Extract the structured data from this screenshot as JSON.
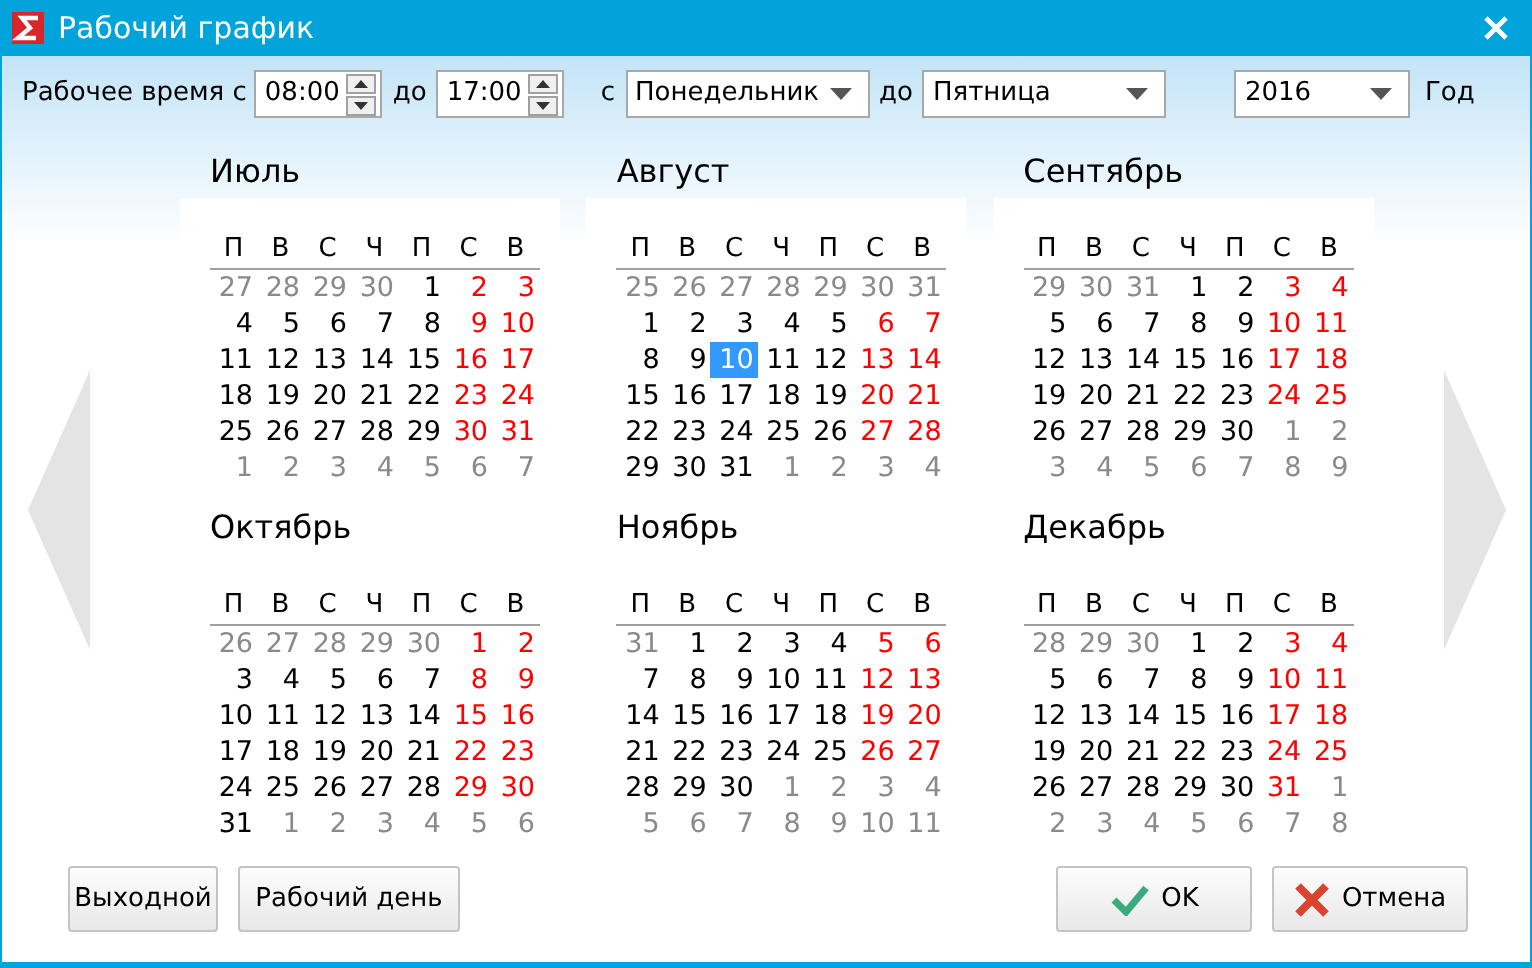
{
  "window": {
    "title": "Рабочий график"
  },
  "toolbar": {
    "time_label": "Рабочее время с",
    "time_from": "08:00",
    "time_to_label": "до",
    "time_to": "17:00",
    "day_from_label": "с",
    "day_from": "Понедельник",
    "day_to_label": "до",
    "day_to": "Пятница",
    "year": "2016",
    "year_label": "Год"
  },
  "months": [
    {
      "name": "Июль",
      "weekdays": [
        "П",
        "В",
        "С",
        "Ч",
        "П",
        "С",
        "В"
      ],
      "weeks": [
        [
          {
            "text": "27",
            "kind": "other",
            "selected": false
          },
          {
            "text": "28",
            "kind": "other",
            "selected": false
          },
          {
            "text": "29",
            "kind": "other",
            "selected": false
          },
          {
            "text": "30",
            "kind": "other",
            "selected": false
          },
          {
            "text": "1",
            "kind": "work",
            "selected": false
          },
          {
            "text": "2",
            "kind": "weekend",
            "selected": false
          },
          {
            "text": "3",
            "kind": "weekend",
            "selected": false
          }
        ],
        [
          {
            "text": "4",
            "kind": "work",
            "selected": false
          },
          {
            "text": "5",
            "kind": "work",
            "selected": false
          },
          {
            "text": "6",
            "kind": "work",
            "selected": false
          },
          {
            "text": "7",
            "kind": "work",
            "selected": false
          },
          {
            "text": "8",
            "kind": "work",
            "selected": false
          },
          {
            "text": "9",
            "kind": "weekend",
            "selected": false
          },
          {
            "text": "10",
            "kind": "weekend",
            "selected": false
          }
        ],
        [
          {
            "text": "11",
            "kind": "work",
            "selected": false
          },
          {
            "text": "12",
            "kind": "work",
            "selected": false
          },
          {
            "text": "13",
            "kind": "work",
            "selected": false
          },
          {
            "text": "14",
            "kind": "work",
            "selected": false
          },
          {
            "text": "15",
            "kind": "work",
            "selected": false
          },
          {
            "text": "16",
            "kind": "weekend",
            "selected": false
          },
          {
            "text": "17",
            "kind": "weekend",
            "selected": false
          }
        ],
        [
          {
            "text": "18",
            "kind": "work",
            "selected": false
          },
          {
            "text": "19",
            "kind": "work",
            "selected": false
          },
          {
            "text": "20",
            "kind": "work",
            "selected": false
          },
          {
            "text": "21",
            "kind": "work",
            "selected": false
          },
          {
            "text": "22",
            "kind": "work",
            "selected": false
          },
          {
            "text": "23",
            "kind": "weekend",
            "selected": false
          },
          {
            "text": "24",
            "kind": "weekend",
            "selected": false
          }
        ],
        [
          {
            "text": "25",
            "kind": "work",
            "selected": false
          },
          {
            "text": "26",
            "kind": "work",
            "selected": false
          },
          {
            "text": "27",
            "kind": "work",
            "selected": false
          },
          {
            "text": "28",
            "kind": "work",
            "selected": false
          },
          {
            "text": "29",
            "kind": "work",
            "selected": false
          },
          {
            "text": "30",
            "kind": "weekend",
            "selected": false
          },
          {
            "text": "31",
            "kind": "weekend",
            "selected": false
          }
        ],
        [
          {
            "text": "1",
            "kind": "other",
            "selected": false
          },
          {
            "text": "2",
            "kind": "other",
            "selected": false
          },
          {
            "text": "3",
            "kind": "other",
            "selected": false
          },
          {
            "text": "4",
            "kind": "other",
            "selected": false
          },
          {
            "text": "5",
            "kind": "other",
            "selected": false
          },
          {
            "text": "6",
            "kind": "other",
            "selected": false
          },
          {
            "text": "7",
            "kind": "other",
            "selected": false
          }
        ]
      ]
    },
    {
      "name": "Август",
      "weekdays": [
        "П",
        "В",
        "С",
        "Ч",
        "П",
        "С",
        "В"
      ],
      "weeks": [
        [
          {
            "text": "25",
            "kind": "other",
            "selected": false
          },
          {
            "text": "26",
            "kind": "other",
            "selected": false
          },
          {
            "text": "27",
            "kind": "other",
            "selected": false
          },
          {
            "text": "28",
            "kind": "other",
            "selected": false
          },
          {
            "text": "29",
            "kind": "other",
            "selected": false
          },
          {
            "text": "30",
            "kind": "other",
            "selected": false
          },
          {
            "text": "31",
            "kind": "other",
            "selected": false
          }
        ],
        [
          {
            "text": "1",
            "kind": "work",
            "selected": false
          },
          {
            "text": "2",
            "kind": "work",
            "selected": false
          },
          {
            "text": "3",
            "kind": "work",
            "selected": false
          },
          {
            "text": "4",
            "kind": "work",
            "selected": false
          },
          {
            "text": "5",
            "kind": "work",
            "selected": false
          },
          {
            "text": "6",
            "kind": "weekend",
            "selected": false
          },
          {
            "text": "7",
            "kind": "weekend",
            "selected": false
          }
        ],
        [
          {
            "text": "8",
            "kind": "work",
            "selected": false
          },
          {
            "text": "9",
            "kind": "work",
            "selected": false
          },
          {
            "text": "10",
            "kind": "work",
            "selected": true
          },
          {
            "text": "11",
            "kind": "work",
            "selected": false
          },
          {
            "text": "12",
            "kind": "work",
            "selected": false
          },
          {
            "text": "13",
            "kind": "weekend",
            "selected": false
          },
          {
            "text": "14",
            "kind": "weekend",
            "selected": false
          }
        ],
        [
          {
            "text": "15",
            "kind": "work",
            "selected": false
          },
          {
            "text": "16",
            "kind": "work",
            "selected": false
          },
          {
            "text": "17",
            "kind": "work",
            "selected": false
          },
          {
            "text": "18",
            "kind": "work",
            "selected": false
          },
          {
            "text": "19",
            "kind": "work",
            "selected": false
          },
          {
            "text": "20",
            "kind": "weekend",
            "selected": false
          },
          {
            "text": "21",
            "kind": "weekend",
            "selected": false
          }
        ],
        [
          {
            "text": "22",
            "kind": "work",
            "selected": false
          },
          {
            "text": "23",
            "kind": "work",
            "selected": false
          },
          {
            "text": "24",
            "kind": "work",
            "selected": false
          },
          {
            "text": "25",
            "kind": "work",
            "selected": false
          },
          {
            "text": "26",
            "kind": "work",
            "selected": false
          },
          {
            "text": "27",
            "kind": "weekend",
            "selected": false
          },
          {
            "text": "28",
            "kind": "weekend",
            "selected": false
          }
        ],
        [
          {
            "text": "29",
            "kind": "work",
            "selected": false
          },
          {
            "text": "30",
            "kind": "work",
            "selected": false
          },
          {
            "text": "31",
            "kind": "work",
            "selected": false
          },
          {
            "text": "1",
            "kind": "other",
            "selected": false
          },
          {
            "text": "2",
            "kind": "other",
            "selected": false
          },
          {
            "text": "3",
            "kind": "other",
            "selected": false
          },
          {
            "text": "4",
            "kind": "other",
            "selected": false
          }
        ]
      ]
    },
    {
      "name": "Сентябрь",
      "weekdays": [
        "П",
        "В",
        "С",
        "Ч",
        "П",
        "С",
        "В"
      ],
      "weeks": [
        [
          {
            "text": "29",
            "kind": "other",
            "selected": false
          },
          {
            "text": "30",
            "kind": "other",
            "selected": false
          },
          {
            "text": "31",
            "kind": "other",
            "selected": false
          },
          {
            "text": "1",
            "kind": "work",
            "selected": false
          },
          {
            "text": "2",
            "kind": "work",
            "selected": false
          },
          {
            "text": "3",
            "kind": "weekend",
            "selected": false
          },
          {
            "text": "4",
            "kind": "weekend",
            "selected": false
          }
        ],
        [
          {
            "text": "5",
            "kind": "work",
            "selected": false
          },
          {
            "text": "6",
            "kind": "work",
            "selected": false
          },
          {
            "text": "7",
            "kind": "work",
            "selected": false
          },
          {
            "text": "8",
            "kind": "work",
            "selected": false
          },
          {
            "text": "9",
            "kind": "work",
            "selected": false
          },
          {
            "text": "10",
            "kind": "weekend",
            "selected": false
          },
          {
            "text": "11",
            "kind": "weekend",
            "selected": false
          }
        ],
        [
          {
            "text": "12",
            "kind": "work",
            "selected": false
          },
          {
            "text": "13",
            "kind": "work",
            "selected": false
          },
          {
            "text": "14",
            "kind": "work",
            "selected": false
          },
          {
            "text": "15",
            "kind": "work",
            "selected": false
          },
          {
            "text": "16",
            "kind": "work",
            "selected": false
          },
          {
            "text": "17",
            "kind": "weekend",
            "selected": false
          },
          {
            "text": "18",
            "kind": "weekend",
            "selected": false
          }
        ],
        [
          {
            "text": "19",
            "kind": "work",
            "selected": false
          },
          {
            "text": "20",
            "kind": "work",
            "selected": false
          },
          {
            "text": "21",
            "kind": "work",
            "selected": false
          },
          {
            "text": "22",
            "kind": "work",
            "selected": false
          },
          {
            "text": "23",
            "kind": "work",
            "selected": false
          },
          {
            "text": "24",
            "kind": "weekend",
            "selected": false
          },
          {
            "text": "25",
            "kind": "weekend",
            "selected": false
          }
        ],
        [
          {
            "text": "26",
            "kind": "work",
            "selected": false
          },
          {
            "text": "27",
            "kind": "work",
            "selected": false
          },
          {
            "text": "28",
            "kind": "work",
            "selected": false
          },
          {
            "text": "29",
            "kind": "work",
            "selected": false
          },
          {
            "text": "30",
            "kind": "work",
            "selected": false
          },
          {
            "text": "1",
            "kind": "other",
            "selected": false
          },
          {
            "text": "2",
            "kind": "other",
            "selected": false
          }
        ],
        [
          {
            "text": "3",
            "kind": "other",
            "selected": false
          },
          {
            "text": "4",
            "kind": "other",
            "selected": false
          },
          {
            "text": "5",
            "kind": "other",
            "selected": false
          },
          {
            "text": "6",
            "kind": "other",
            "selected": false
          },
          {
            "text": "7",
            "kind": "other",
            "selected": false
          },
          {
            "text": "8",
            "kind": "other",
            "selected": false
          },
          {
            "text": "9",
            "kind": "other",
            "selected": false
          }
        ]
      ]
    },
    {
      "name": "Октябрь",
      "weekdays": [
        "П",
        "В",
        "С",
        "Ч",
        "П",
        "С",
        "В"
      ],
      "weeks": [
        [
          {
            "text": "26",
            "kind": "other",
            "selected": false
          },
          {
            "text": "27",
            "kind": "other",
            "selected": false
          },
          {
            "text": "28",
            "kind": "other",
            "selected": false
          },
          {
            "text": "29",
            "kind": "other",
            "selected": false
          },
          {
            "text": "30",
            "kind": "other",
            "selected": false
          },
          {
            "text": "1",
            "kind": "weekend",
            "selected": false
          },
          {
            "text": "2",
            "kind": "weekend",
            "selected": false
          }
        ],
        [
          {
            "text": "3",
            "kind": "work",
            "selected": false
          },
          {
            "text": "4",
            "kind": "work",
            "selected": false
          },
          {
            "text": "5",
            "kind": "work",
            "selected": false
          },
          {
            "text": "6",
            "kind": "work",
            "selected": false
          },
          {
            "text": "7",
            "kind": "work",
            "selected": false
          },
          {
            "text": "8",
            "kind": "weekend",
            "selected": false
          },
          {
            "text": "9",
            "kind": "weekend",
            "selected": false
          }
        ],
        [
          {
            "text": "10",
            "kind": "work",
            "selected": false
          },
          {
            "text": "11",
            "kind": "work",
            "selected": false
          },
          {
            "text": "12",
            "kind": "work",
            "selected": false
          },
          {
            "text": "13",
            "kind": "work",
            "selected": false
          },
          {
            "text": "14",
            "kind": "work",
            "selected": false
          },
          {
            "text": "15",
            "kind": "weekend",
            "selected": false
          },
          {
            "text": "16",
            "kind": "weekend",
            "selected": false
          }
        ],
        [
          {
            "text": "17",
            "kind": "work",
            "selected": false
          },
          {
            "text": "18",
            "kind": "work",
            "selected": false
          },
          {
            "text": "19",
            "kind": "work",
            "selected": false
          },
          {
            "text": "20",
            "kind": "work",
            "selected": false
          },
          {
            "text": "21",
            "kind": "work",
            "selected": false
          },
          {
            "text": "22",
            "kind": "weekend",
            "selected": false
          },
          {
            "text": "23",
            "kind": "weekend",
            "selected": false
          }
        ],
        [
          {
            "text": "24",
            "kind": "work",
            "selected": false
          },
          {
            "text": "25",
            "kind": "work",
            "selected": false
          },
          {
            "text": "26",
            "kind": "work",
            "selected": false
          },
          {
            "text": "27",
            "kind": "work",
            "selected": false
          },
          {
            "text": "28",
            "kind": "work",
            "selected": false
          },
          {
            "text": "29",
            "kind": "weekend",
            "selected": false
          },
          {
            "text": "30",
            "kind": "weekend",
            "selected": false
          }
        ],
        [
          {
            "text": "31",
            "kind": "work",
            "selected": false
          },
          {
            "text": "1",
            "kind": "other",
            "selected": false
          },
          {
            "text": "2",
            "kind": "other",
            "selected": false
          },
          {
            "text": "3",
            "kind": "other",
            "selected": false
          },
          {
            "text": "4",
            "kind": "other",
            "selected": false
          },
          {
            "text": "5",
            "kind": "other",
            "selected": false
          },
          {
            "text": "6",
            "kind": "other",
            "selected": false
          }
        ]
      ]
    },
    {
      "name": "Ноябрь",
      "weekdays": [
        "П",
        "В",
        "С",
        "Ч",
        "П",
        "С",
        "В"
      ],
      "weeks": [
        [
          {
            "text": "31",
            "kind": "other",
            "selected": false
          },
          {
            "text": "1",
            "kind": "work",
            "selected": false
          },
          {
            "text": "2",
            "kind": "work",
            "selected": false
          },
          {
            "text": "3",
            "kind": "work",
            "selected": false
          },
          {
            "text": "4",
            "kind": "work",
            "selected": false
          },
          {
            "text": "5",
            "kind": "weekend",
            "selected": false
          },
          {
            "text": "6",
            "kind": "weekend",
            "selected": false
          }
        ],
        [
          {
            "text": "7",
            "kind": "work",
            "selected": false
          },
          {
            "text": "8",
            "kind": "work",
            "selected": false
          },
          {
            "text": "9",
            "kind": "work",
            "selected": false
          },
          {
            "text": "10",
            "kind": "work",
            "selected": false
          },
          {
            "text": "11",
            "kind": "work",
            "selected": false
          },
          {
            "text": "12",
            "kind": "weekend",
            "selected": false
          },
          {
            "text": "13",
            "kind": "weekend",
            "selected": false
          }
        ],
        [
          {
            "text": "14",
            "kind": "work",
            "selected": false
          },
          {
            "text": "15",
            "kind": "work",
            "selected": false
          },
          {
            "text": "16",
            "kind": "work",
            "selected": false
          },
          {
            "text": "17",
            "kind": "work",
            "selected": false
          },
          {
            "text": "18",
            "kind": "work",
            "selected": false
          },
          {
            "text": "19",
            "kind": "weekend",
            "selected": false
          },
          {
            "text": "20",
            "kind": "weekend",
            "selected": false
          }
        ],
        [
          {
            "text": "21",
            "kind": "work",
            "selected": false
          },
          {
            "text": "22",
            "kind": "work",
            "selected": false
          },
          {
            "text": "23",
            "kind": "work",
            "selected": false
          },
          {
            "text": "24",
            "kind": "work",
            "selected": false
          },
          {
            "text": "25",
            "kind": "work",
            "selected": false
          },
          {
            "text": "26",
            "kind": "weekend",
            "selected": false
          },
          {
            "text": "27",
            "kind": "weekend",
            "selected": false
          }
        ],
        [
          {
            "text": "28",
            "kind": "work",
            "selected": false
          },
          {
            "text": "29",
            "kind": "work",
            "selected": false
          },
          {
            "text": "30",
            "kind": "work",
            "selected": false
          },
          {
            "text": "1",
            "kind": "other",
            "selected": false
          },
          {
            "text": "2",
            "kind": "other",
            "selected": false
          },
          {
            "text": "3",
            "kind": "other",
            "selected": false
          },
          {
            "text": "4",
            "kind": "other",
            "selected": false
          }
        ],
        [
          {
            "text": "5",
            "kind": "other",
            "selected": false
          },
          {
            "text": "6",
            "kind": "other",
            "selected": false
          },
          {
            "text": "7",
            "kind": "other",
            "selected": false
          },
          {
            "text": "8",
            "kind": "other",
            "selected": false
          },
          {
            "text": "9",
            "kind": "other",
            "selected": false
          },
          {
            "text": "10",
            "kind": "other",
            "selected": false
          },
          {
            "text": "11",
            "kind": "other",
            "selected": false
          }
        ]
      ]
    },
    {
      "name": "Декабрь",
      "weekdays": [
        "П",
        "В",
        "С",
        "Ч",
        "П",
        "С",
        "В"
      ],
      "weeks": [
        [
          {
            "text": "28",
            "kind": "other",
            "selected": false
          },
          {
            "text": "29",
            "kind": "other",
            "selected": false
          },
          {
            "text": "30",
            "kind": "other",
            "selected": false
          },
          {
            "text": "1",
            "kind": "work",
            "selected": false
          },
          {
            "text": "2",
            "kind": "work",
            "selected": false
          },
          {
            "text": "3",
            "kind": "weekend",
            "selected": false
          },
          {
            "text": "4",
            "kind": "weekend",
            "selected": false
          }
        ],
        [
          {
            "text": "5",
            "kind": "work",
            "selected": false
          },
          {
            "text": "6",
            "kind": "work",
            "selected": false
          },
          {
            "text": "7",
            "kind": "work",
            "selected": false
          },
          {
            "text": "8",
            "kind": "work",
            "selected": false
          },
          {
            "text": "9",
            "kind": "work",
            "selected": false
          },
          {
            "text": "10",
            "kind": "weekend",
            "selected": false
          },
          {
            "text": "11",
            "kind": "weekend",
            "selected": false
          }
        ],
        [
          {
            "text": "12",
            "kind": "work",
            "selected": false
          },
          {
            "text": "13",
            "kind": "work",
            "selected": false
          },
          {
            "text": "14",
            "kind": "work",
            "selected": false
          },
          {
            "text": "15",
            "kind": "work",
            "selected": false
          },
          {
            "text": "16",
            "kind": "work",
            "selected": false
          },
          {
            "text": "17",
            "kind": "weekend",
            "selected": false
          },
          {
            "text": "18",
            "kind": "weekend",
            "selected": false
          }
        ],
        [
          {
            "text": "19",
            "kind": "work",
            "selected": false
          },
          {
            "text": "20",
            "kind": "work",
            "selected": false
          },
          {
            "text": "21",
            "kind": "work",
            "selected": false
          },
          {
            "text": "22",
            "kind": "work",
            "selected": false
          },
          {
            "text": "23",
            "kind": "work",
            "selected": false
          },
          {
            "text": "24",
            "kind": "weekend",
            "selected": false
          },
          {
            "text": "25",
            "kind": "weekend",
            "selected": false
          }
        ],
        [
          {
            "text": "26",
            "kind": "work",
            "selected": false
          },
          {
            "text": "27",
            "kind": "work",
            "selected": false
          },
          {
            "text": "28",
            "kind": "work",
            "selected": false
          },
          {
            "text": "29",
            "kind": "work",
            "selected": false
          },
          {
            "text": "30",
            "kind": "work",
            "selected": false
          },
          {
            "text": "31",
            "kind": "weekend",
            "selected": false
          },
          {
            "text": "1",
            "kind": "other",
            "selected": false
          }
        ],
        [
          {
            "text": "2",
            "kind": "other",
            "selected": false
          },
          {
            "text": "3",
            "kind": "other",
            "selected": false
          },
          {
            "text": "4",
            "kind": "other",
            "selected": false
          },
          {
            "text": "5",
            "kind": "other",
            "selected": false
          },
          {
            "text": "6",
            "kind": "other",
            "selected": false
          },
          {
            "text": "7",
            "kind": "other",
            "selected": false
          },
          {
            "text": "8",
            "kind": "other",
            "selected": false
          }
        ]
      ]
    }
  ],
  "buttons": {
    "day_off": "Выходной",
    "work_day": "Рабочий день",
    "ok": "OK",
    "cancel": "Отмена"
  }
}
